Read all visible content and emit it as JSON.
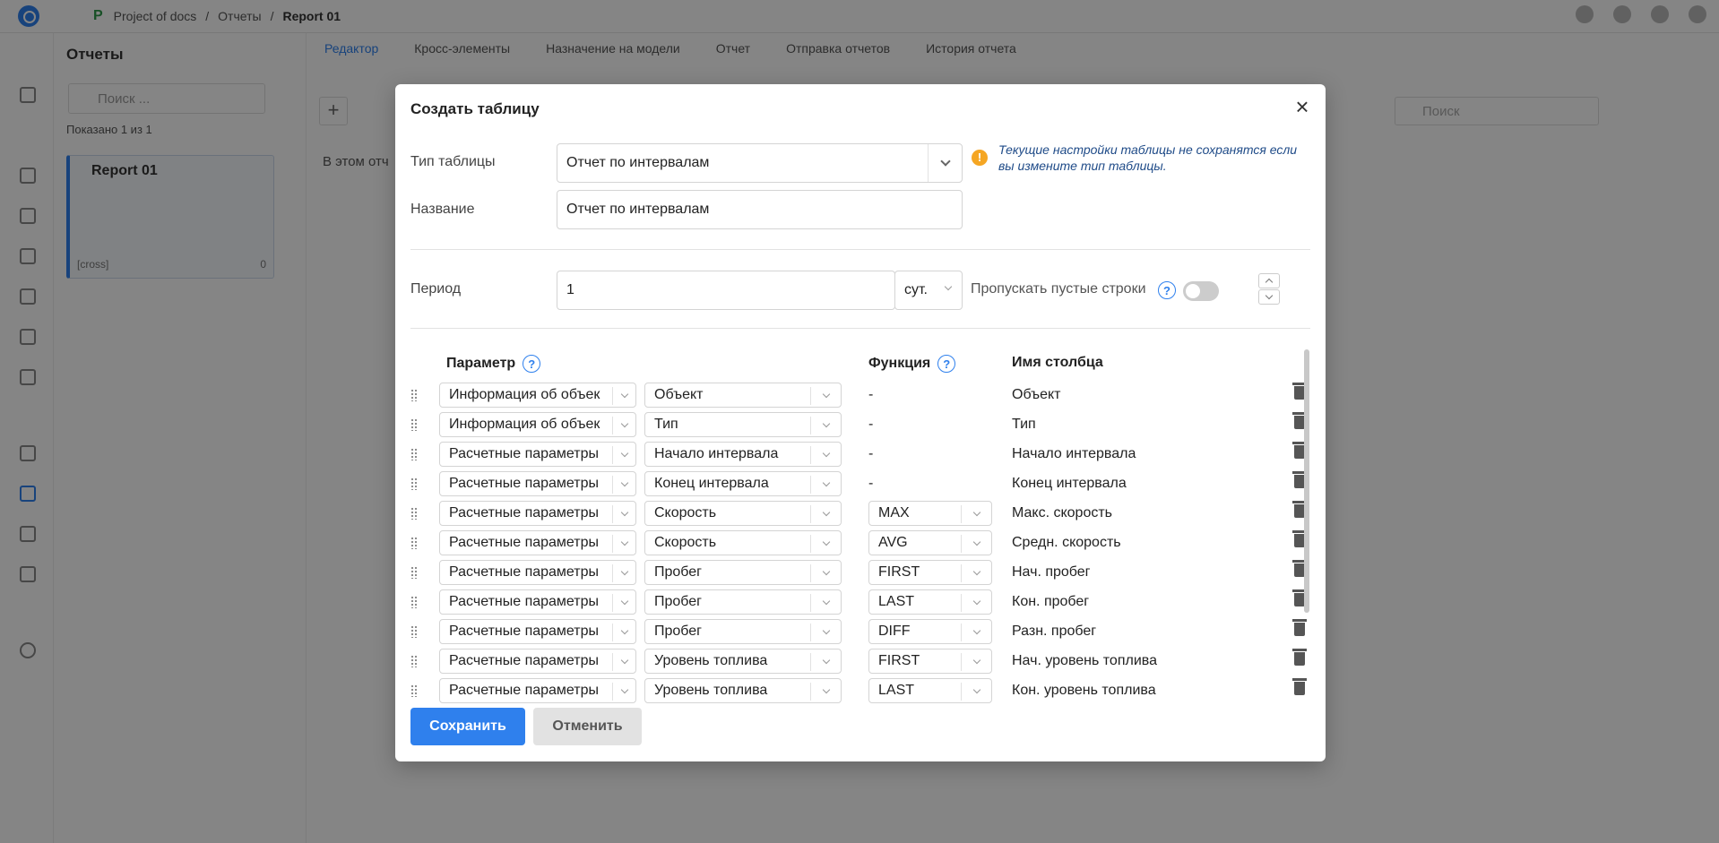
{
  "app": {
    "project_badge": "P",
    "breadcrumb": [
      "Project of docs",
      "/",
      "Отчеты",
      "/",
      "Report 01"
    ]
  },
  "reports_panel": {
    "title": "Отчеты",
    "search_placeholder": "Поиск ...",
    "count_text": "Показано 1 из 1",
    "card": {
      "title": "Report 01",
      "tag": "[cross]",
      "count": "0"
    }
  },
  "tabs": [
    "Редактор",
    "Кросс-элементы",
    "Назначение на модели",
    "Отчет",
    "Отправка отчетов",
    "История отчета"
  ],
  "editor": {
    "note": "В этом отч",
    "search_placeholder": "Поиск"
  },
  "modal": {
    "title": "Создать таблицу",
    "close": "×",
    "table_type_label": "Тип таблицы",
    "table_type_value": "Отчет по интервалам",
    "warning_icon": "!",
    "warning": "Текущие настройки таблицы не сохранятся если вы измените тип таблицы.",
    "name_label": "Название",
    "name_value": "Отчет по интервалам",
    "period_label": "Период",
    "period_value": "1",
    "period_unit": "сут.",
    "skip_empty_label": "Пропускать пустые строки",
    "help_glyph": "?",
    "skip_empty_enabled": false,
    "columns": {
      "param": "Параметр",
      "function": "Функция",
      "col_name": "Имя столбца"
    },
    "rows": [
      {
        "group": "Информация об объек",
        "param": "Объект",
        "func": "-",
        "name": "Объект"
      },
      {
        "group": "Информация об объек",
        "param": "Тип",
        "func": "-",
        "name": "Тип"
      },
      {
        "group": "Расчетные параметры",
        "param": "Начало интервала",
        "func": "-",
        "name": "Начало интервала"
      },
      {
        "group": "Расчетные параметры",
        "param": "Конец интервала",
        "func": "-",
        "name": "Конец интервала"
      },
      {
        "group": "Расчетные параметры",
        "param": "Скорость",
        "func": "MAX",
        "name": "Макс. скорость"
      },
      {
        "group": "Расчетные параметры",
        "param": "Скорость",
        "func": "AVG",
        "name": "Средн. скорость"
      },
      {
        "group": "Расчетные параметры",
        "param": "Пробег",
        "func": "FIRST",
        "name": "Нач. пробег"
      },
      {
        "group": "Расчетные параметры",
        "param": "Пробег",
        "func": "LAST",
        "name": "Кон. пробег"
      },
      {
        "group": "Расчетные параметры",
        "param": "Пробег",
        "func": "DIFF",
        "name": "Разн. пробег"
      },
      {
        "group": "Расчетные параметры",
        "param": "Уровень топлива",
        "func": "FIRST",
        "name": "Нач. уровень топлива"
      },
      {
        "group": "Расчетные параметры",
        "param": "Уровень топлива",
        "func": "LAST",
        "name": "Кон. уровень топлива"
      }
    ],
    "save_label": "Сохранить",
    "cancel_label": "Отменить"
  },
  "colors": {
    "accent": "#2f80ed",
    "warning": "#f5a623",
    "overlay": "rgba(0,0,0,0.48)"
  }
}
